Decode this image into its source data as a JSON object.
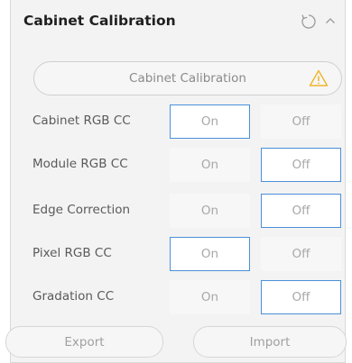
{
  "header": {
    "title": "Cabinet Calibration",
    "icons": [
      "refresh-icon",
      "chevron-up-icon"
    ]
  },
  "main_button": {
    "label": "Cabinet Calibration",
    "icon": "warning-icon",
    "icon_color": "#f0b429"
  },
  "rows": [
    {
      "label": "Cabinet RGB CC",
      "on_label": "On",
      "off_label": "Off",
      "selected": "On"
    },
    {
      "label": "Module RGB CC",
      "on_label": "On",
      "off_label": "Off",
      "selected": "Off"
    },
    {
      "label": "Edge Correction",
      "on_label": "On",
      "off_label": "Off",
      "selected": "Off"
    },
    {
      "label": "Pixel RGB CC",
      "on_label": "On",
      "off_label": "Off",
      "selected": "On"
    },
    {
      "label": "Gradation CC",
      "on_label": "On",
      "off_label": "Off",
      "selected": "Off"
    }
  ],
  "footer": {
    "export_label": "Export",
    "import_label": "Import"
  },
  "colors": {
    "selected_border": "#4a90d9",
    "panel_bg": "#f3f3f3"
  }
}
